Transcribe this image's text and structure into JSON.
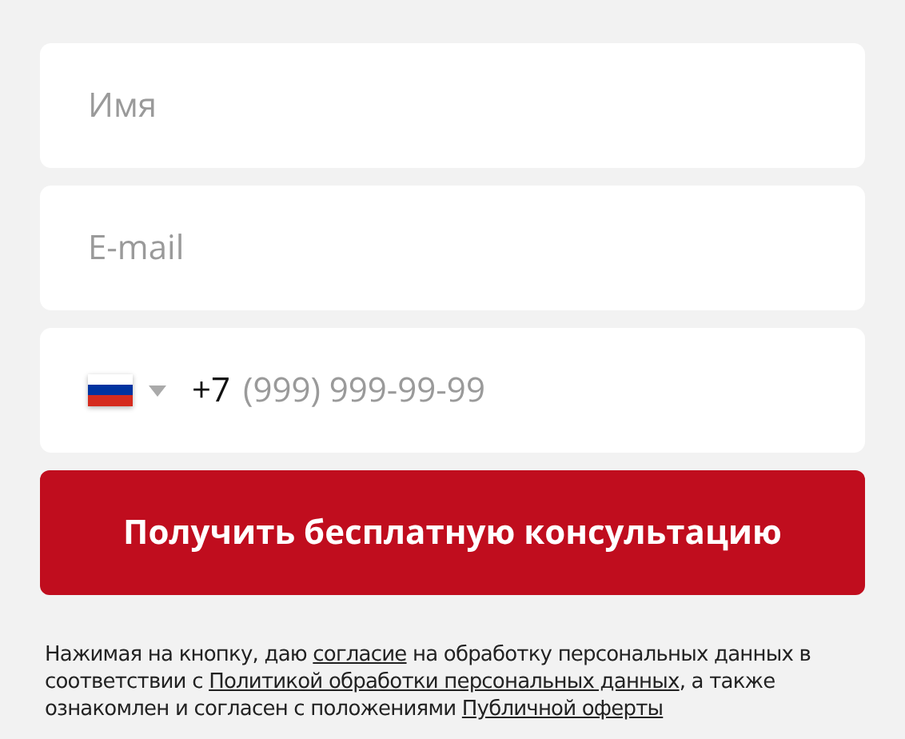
{
  "name_field": {
    "placeholder": "Имя"
  },
  "email_field": {
    "placeholder": "E-mail"
  },
  "phone_field": {
    "prefix": "+7",
    "placeholder": "(999) 999-99-99"
  },
  "submit_button": {
    "label": "Получить бесплатную консультацию"
  },
  "consent": [
    {
      "kind": "text",
      "text": "Нажимая на кнопку, даю "
    },
    {
      "kind": "link",
      "text": "согласие"
    },
    {
      "kind": "text",
      "text": " на обработку персональных данных в соответствии с "
    },
    {
      "kind": "link",
      "text": "Политикой обработки персональных данных"
    },
    {
      "kind": "text",
      "text": ", а также ознакомлен и согласен с положениями "
    },
    {
      "kind": "link",
      "text": "Публичной оферты"
    }
  ]
}
